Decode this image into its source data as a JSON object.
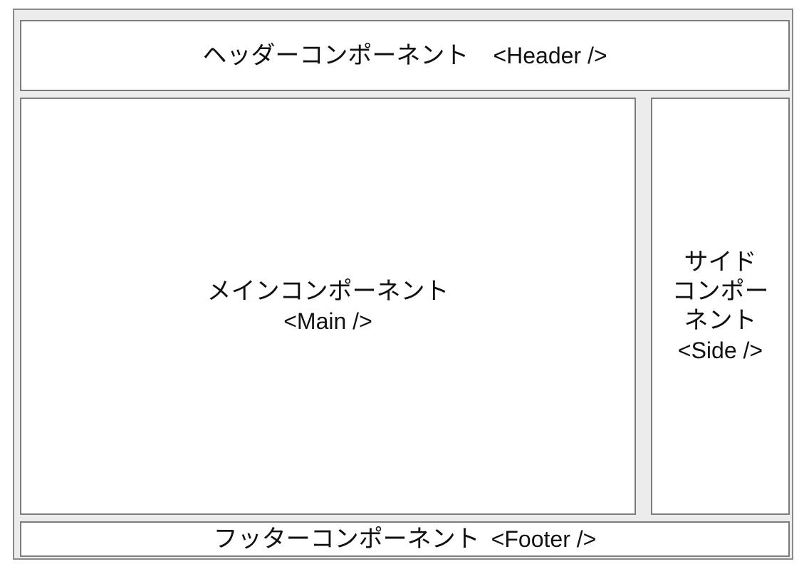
{
  "header": {
    "label": "ヘッダーコンポーネント",
    "tag": "<Header />"
  },
  "main": {
    "label": "メインコンポーネント",
    "tag": "<Main />"
  },
  "side": {
    "label_lines": [
      "サイド",
      "コンポー",
      "ネント"
    ],
    "tag": "<Side />"
  },
  "footer": {
    "label": "フッターコンポーネント",
    "tag": "<Footer />"
  },
  "colors": {
    "background": "#ececec",
    "box": "#ffffff",
    "border": "#7c7c7c",
    "text": "#111111"
  }
}
